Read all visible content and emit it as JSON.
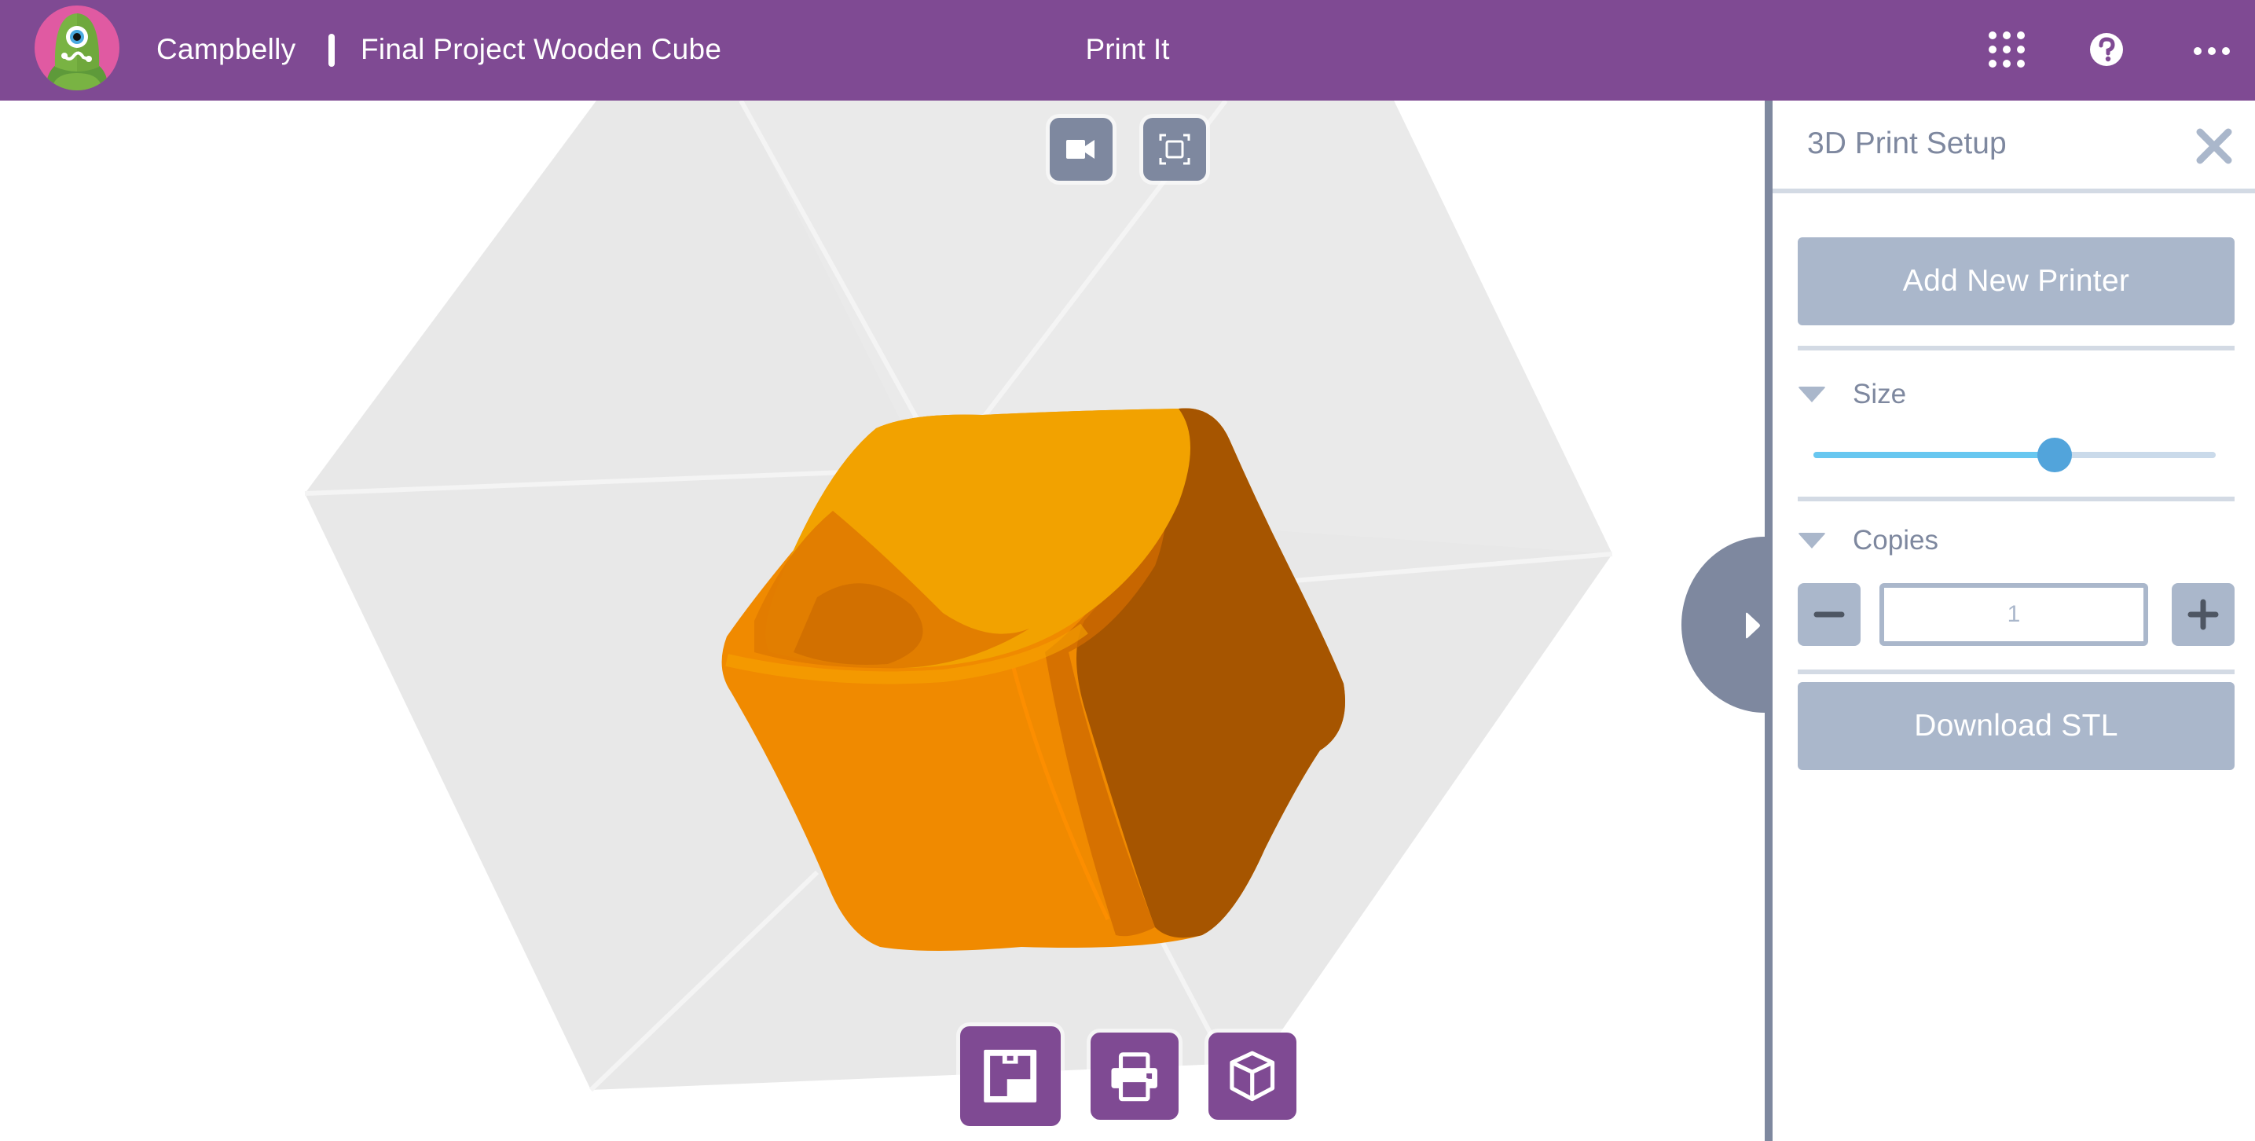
{
  "header": {
    "brand": "Campbelly",
    "project_title": "Final Project Wooden Cube",
    "page_label": "Print It",
    "icons": {
      "apps": "grid-dots-icon",
      "help": "question-circle-icon",
      "more": "more-horizontal-icon"
    }
  },
  "viewport": {
    "top_controls": [
      {
        "name": "camera-view-button",
        "icon": "video-camera-icon"
      },
      {
        "name": "fit-view-button",
        "icon": "frame-corners-icon"
      }
    ],
    "bottom_tools": [
      {
        "name": "build-plate-button",
        "icon": "build-plate-icon",
        "selected": true
      },
      {
        "name": "print-button",
        "icon": "printer-icon",
        "selected": false
      },
      {
        "name": "model-button",
        "icon": "cube-outline-icon",
        "selected": false
      }
    ],
    "model": {
      "label": "Final Project Wooden Cube",
      "color_light": "#F2A200",
      "color_mid": "#F08A00",
      "color_dark": "#A65500"
    }
  },
  "panel": {
    "title": "3D Print Setup",
    "add_printer_label": "Add New Printer",
    "size": {
      "label": "Size",
      "value_fraction": 0.6
    },
    "copies": {
      "label": "Copies",
      "value": "1",
      "decrement_icon": "minus-icon",
      "increment_icon": "plus-icon"
    },
    "download_label": "Download STL"
  },
  "colors": {
    "brand_purple": "#7F4A93",
    "slate": "#7E889F",
    "muted_button": "#AAB7CB",
    "slider_fill": "#68C7F0",
    "slider_knob": "#52A4DB"
  }
}
